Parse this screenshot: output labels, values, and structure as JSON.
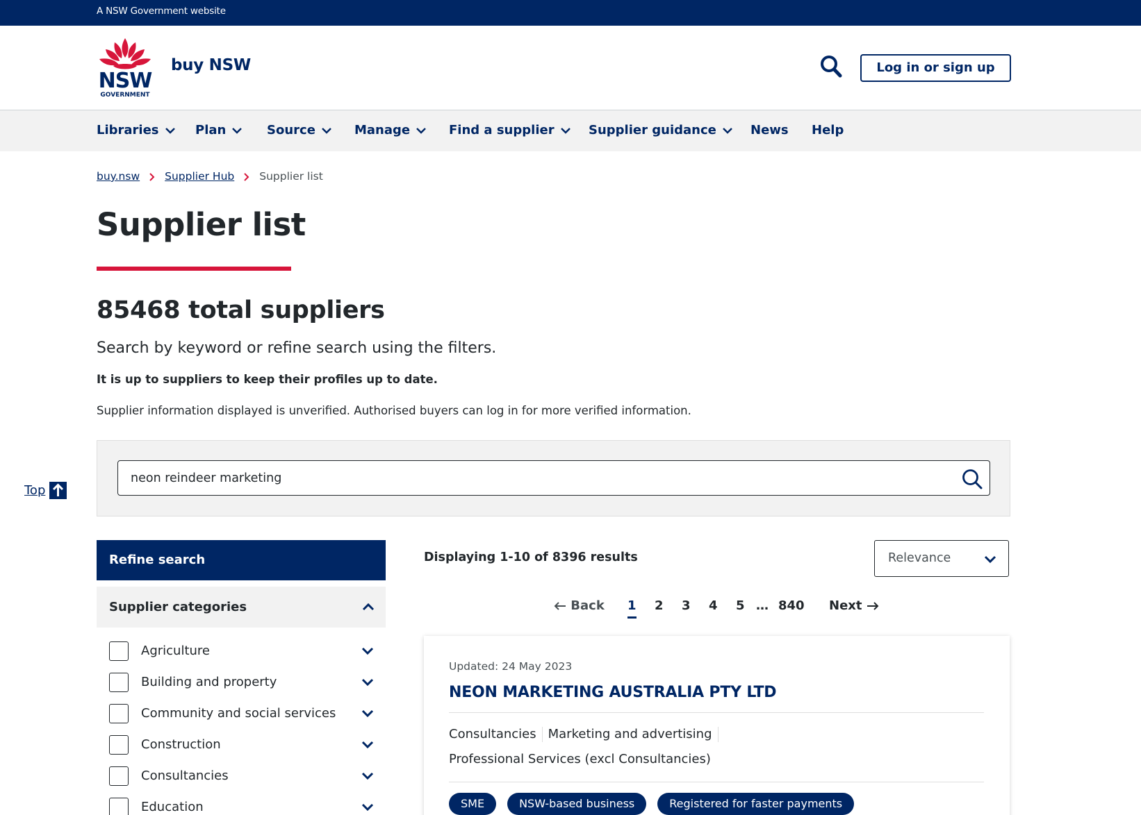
{
  "masthead": {
    "text": "A NSW Government website"
  },
  "header": {
    "logo_text": "NSW",
    "logo_subtext": "GOVERNMENT",
    "site_name": "buy NSW",
    "login_label": "Log in or sign up"
  },
  "nav": {
    "items": [
      {
        "label": "Libraries",
        "dropdown": true
      },
      {
        "label": "Plan",
        "dropdown": true
      },
      {
        "label": "Source",
        "dropdown": true
      },
      {
        "label": "Manage",
        "dropdown": true
      },
      {
        "label": "Find a supplier",
        "dropdown": true
      },
      {
        "label": "Supplier guidance",
        "dropdown": true
      },
      {
        "label": "News",
        "dropdown": false
      },
      {
        "label": "Help",
        "dropdown": false
      }
    ]
  },
  "breadcrumb": {
    "items": [
      "buy.nsw",
      "Supplier Hub"
    ],
    "current": "Supplier list"
  },
  "page": {
    "title": "Supplier list",
    "total": "85468 total suppliers",
    "intro": "Search by keyword or refine search using the filters.",
    "notice": "It is up to suppliers to keep their profiles up to date.",
    "unverified": "Supplier information displayed is unverified. Authorised buyers can log in for more verified information."
  },
  "search": {
    "value": "neon reindeer marketing"
  },
  "top_link": {
    "label": "Top"
  },
  "filters": {
    "title": "Refine search",
    "section": "Supplier categories",
    "categories": [
      "Agriculture",
      "Building and property",
      "Community and social services",
      "Construction",
      "Consultancies",
      "Education"
    ]
  },
  "results": {
    "summary": "Displaying 1-10 of 8396 results",
    "sort": "Relevance",
    "pagination": {
      "back": "Back",
      "pages": [
        "1",
        "2",
        "3",
        "4",
        "5"
      ],
      "ellipsis": "…",
      "last": "840",
      "next": "Next",
      "current": "1"
    },
    "cards": [
      {
        "updated": "Updated: 24 May 2023",
        "name": "NEON MARKETING AUSTRALIA PTY LTD",
        "categories": [
          "Consultancies",
          "Marketing and advertising",
          "Professional Services (excl Consultancies)"
        ],
        "tags": [
          "SME",
          "NSW-based business",
          "Registered for faster payments"
        ]
      }
    ]
  },
  "colors": {
    "navy": "#002664",
    "red": "#d7153a",
    "grey_bg": "#f2f2f2",
    "text": "#22272b"
  }
}
